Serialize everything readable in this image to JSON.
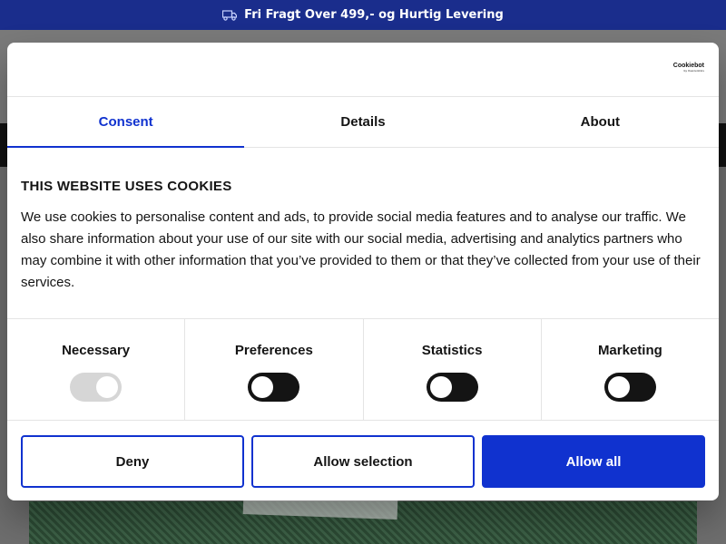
{
  "announcement": {
    "text": "Fri Fragt Over 499,- og Hurtig Levering",
    "icon": "truck-icon"
  },
  "dialog": {
    "logo": {
      "name": "Cookiebot",
      "sub": "by Usercentrics"
    },
    "tabs": [
      {
        "label": "Consent",
        "active": true
      },
      {
        "label": "Details",
        "active": false
      },
      {
        "label": "About",
        "active": false
      }
    ],
    "heading": "THIS WEBSITE USES COOKIES",
    "description": "We use cookies to personalise content and ads, to provide social media features and to analyse our traffic. We also share information about your use of our site with our social media, advertising and analytics partners who may combine it with other information that you’ve provided to them or that they’ve collected from your use of their services.",
    "categories": [
      {
        "label": "Necessary",
        "enabled": true,
        "locked": true
      },
      {
        "label": "Preferences",
        "enabled": false,
        "locked": false
      },
      {
        "label": "Statistics",
        "enabled": false,
        "locked": false
      },
      {
        "label": "Marketing",
        "enabled": false,
        "locked": false
      }
    ],
    "buttons": {
      "deny": "Deny",
      "allow_selection": "Allow selection",
      "allow_all": "Allow all"
    }
  },
  "colors": {
    "brand": "#1a2d8c",
    "accent": "#1032cf",
    "text": "#141414"
  }
}
